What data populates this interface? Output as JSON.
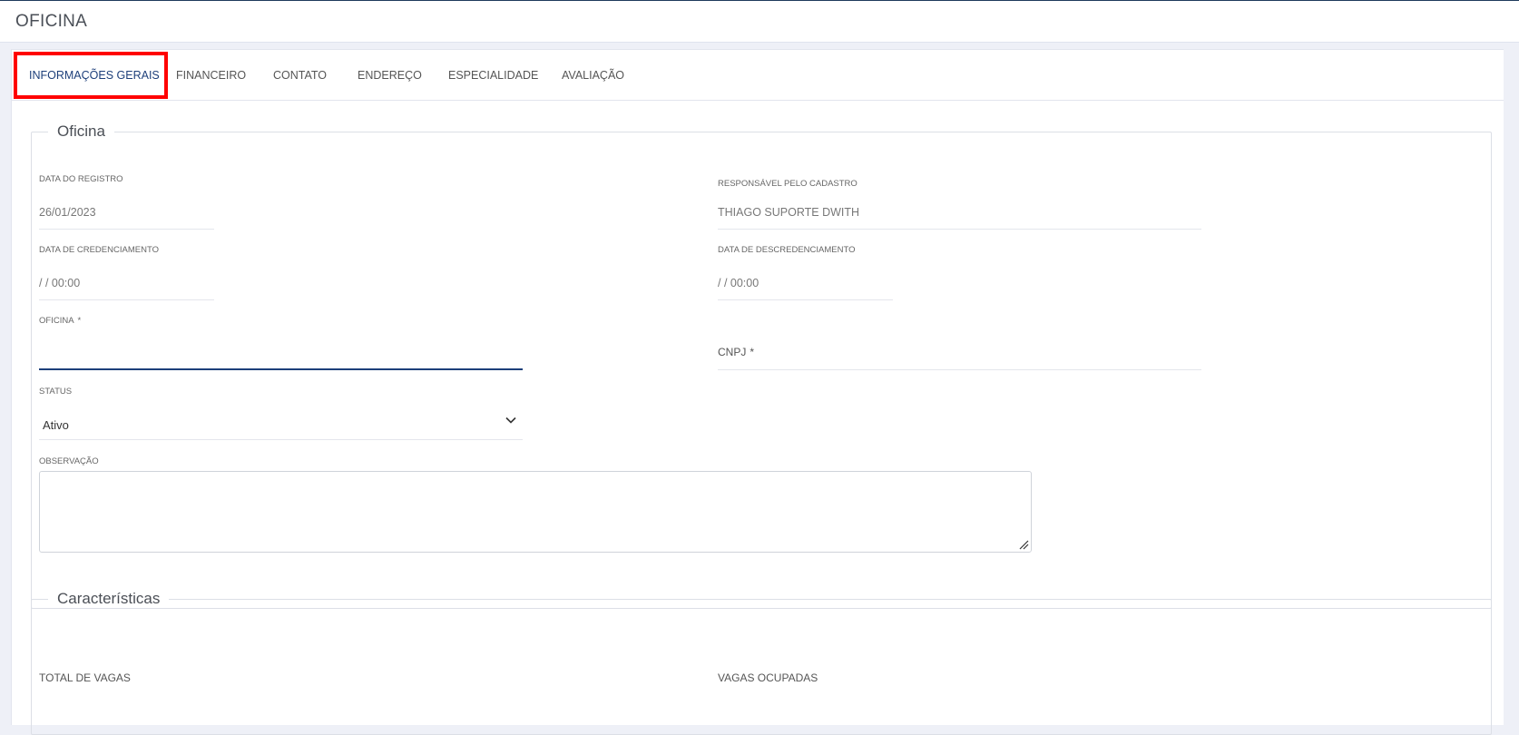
{
  "header": {
    "title": "OFICINA"
  },
  "tabs": [
    {
      "label": "INFORMAÇÕES GERAIS",
      "active": true
    },
    {
      "label": "FINANCEIRO"
    },
    {
      "label": "CONTATO"
    },
    {
      "label": "ENDEREÇO"
    },
    {
      "label": "ESPECIALIDADE"
    },
    {
      "label": "AVALIAÇÃO"
    }
  ],
  "oficina_section": {
    "legend": "Oficina",
    "data_registro": {
      "label": "DATA DO REGISTRO",
      "value": "26/01/2023"
    },
    "responsavel": {
      "label": "RESPONSÁVEL PELO CADASTRO",
      "value": "THIAGO SUPORTE DWITH"
    },
    "data_credenciamento": {
      "label": "DATA DE CREDENCIAMENTO",
      "value": "/ / 00:00"
    },
    "data_descredenciamento": {
      "label": "DATA DE DESCREDENCIAMENTO",
      "value": "/ / 00:00"
    },
    "oficina": {
      "label": "OFICINA",
      "required": "*",
      "value": ""
    },
    "cnpj": {
      "label": "CNPJ",
      "required": "*",
      "value": ""
    },
    "status": {
      "label": "STATUS",
      "value": "Ativo"
    },
    "observacao": {
      "label": "OBSERVAÇÃO",
      "value": ""
    }
  },
  "caracteristicas_section": {
    "legend": "Características",
    "total_vagas": {
      "label": "TOTAL DE VAGAS"
    },
    "vagas_ocupadas": {
      "label": "VAGAS OCUPADAS"
    }
  },
  "colors": {
    "accent": "#1d3f7a",
    "highlight": "#ff0000"
  },
  "icons": {
    "status_dropdown": "chevron-down-icon",
    "textarea_resize": "resize-handle-icon"
  }
}
